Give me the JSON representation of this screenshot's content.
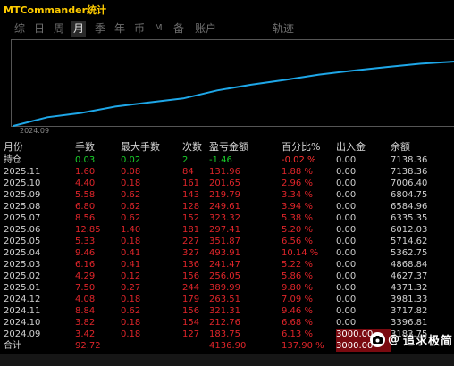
{
  "app": {
    "title": "MTCommander统计"
  },
  "tabs": [
    {
      "label": "综"
    },
    {
      "label": "日"
    },
    {
      "label": "周"
    },
    {
      "label": "月",
      "active": true
    },
    {
      "label": "季"
    },
    {
      "label": "年"
    },
    {
      "label": "币"
    },
    {
      "label": "M"
    },
    {
      "label": "备"
    },
    {
      "label": "账户"
    },
    {
      "label": "轨迹"
    }
  ],
  "chart_data": {
    "type": "line",
    "series": [
      {
        "values": [
          3183.75,
          3717.82,
          3981.33,
          4371.32,
          4627.37,
          4868.84,
          5362.75,
          5714.62,
          6012.03,
          6335.35,
          6584.96,
          6804.75,
          7006.4,
          7138.36
        ]
      }
    ],
    "x_tick_label": "2024.09",
    "line_color": "#1ea7e8"
  },
  "table": {
    "headers": [
      "月份",
      "手数",
      "最大手数",
      "次数",
      "盈亏金额",
      "百分比%",
      "出入金",
      "余额"
    ],
    "holding": [
      "持仓",
      "0.03",
      "0.02",
      "2",
      "-1.46",
      "-0.02 %",
      "0.00",
      "7138.36"
    ],
    "rows": [
      [
        "2025.11",
        "1.60",
        "0.08",
        "84",
        "131.96",
        "1.88 %",
        "0.00",
        "7138.36"
      ],
      [
        "2025.10",
        "4.40",
        "0.18",
        "161",
        "201.65",
        "2.96 %",
        "0.00",
        "7006.40"
      ],
      [
        "2025.09",
        "5.58",
        "0.62",
        "143",
        "219.79",
        "3.34 %",
        "0.00",
        "6804.75"
      ],
      [
        "2025.08",
        "6.80",
        "0.62",
        "128",
        "249.61",
        "3.94 %",
        "0.00",
        "6584.96"
      ],
      [
        "2025.07",
        "8.56",
        "0.62",
        "152",
        "323.32",
        "5.38 %",
        "0.00",
        "6335.35"
      ],
      [
        "2025.06",
        "12.85",
        "1.40",
        "181",
        "297.41",
        "5.20 %",
        "0.00",
        "6012.03"
      ],
      [
        "2025.05",
        "5.33",
        "0.18",
        "227",
        "351.87",
        "6.56 %",
        "0.00",
        "5714.62"
      ],
      [
        "2025.04",
        "9.46",
        "0.41",
        "327",
        "493.91",
        "10.14 %",
        "0.00",
        "5362.75"
      ],
      [
        "2025.03",
        "6.16",
        "0.41",
        "136",
        "241.47",
        "5.22 %",
        "0.00",
        "4868.84"
      ],
      [
        "2025.02",
        "4.29",
        "0.12",
        "156",
        "256.05",
        "5.86 %",
        "0.00",
        "4627.37"
      ],
      [
        "2025.01",
        "7.50",
        "0.27",
        "244",
        "389.99",
        "9.80 %",
        "0.00",
        "4371.32"
      ],
      [
        "2024.12",
        "4.08",
        "0.18",
        "179",
        "263.51",
        "7.09 %",
        "0.00",
        "3981.33"
      ],
      [
        "2024.11",
        "8.84",
        "0.62",
        "156",
        "321.31",
        "9.46 %",
        "0.00",
        "3717.82"
      ],
      [
        "2024.10",
        "3.82",
        "0.18",
        "154",
        "212.76",
        "6.68 %",
        "0.00",
        "3396.81"
      ],
      [
        "2024.09",
        "3.42",
        "0.18",
        "127",
        "183.75",
        "6.13 %",
        "3000.00",
        "3183.75"
      ]
    ],
    "total": [
      "合计",
      "92.72",
      "",
      "",
      "4136.90",
      "137.90 %",
      "3000.00",
      ""
    ]
  },
  "watermark": {
    "text": "追求极简",
    "prefix": "@"
  }
}
